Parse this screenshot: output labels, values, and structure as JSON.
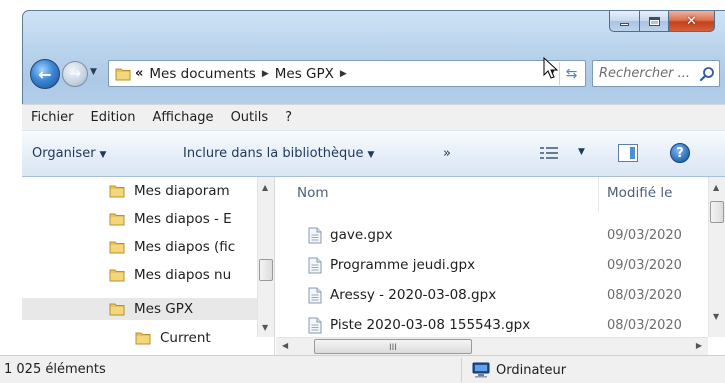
{
  "window": {
    "caption_buttons": [
      "minimize",
      "maximize",
      "close"
    ],
    "accent_color": "#3a86d4"
  },
  "address_bar": {
    "overflow": "«",
    "segments": [
      "Mes documents",
      "Mes GPX"
    ],
    "separator_icon": "chevron-right-icon",
    "dropdown_icon": "chevron-down-icon",
    "refresh_icon": "refresh-icon"
  },
  "search": {
    "placeholder": "Rechercher ...",
    "icon": "search-icon"
  },
  "menu": {
    "items": [
      "Fichier",
      "Edition",
      "Affichage",
      "Outils",
      "?"
    ]
  },
  "commands": {
    "organize": "Organiser",
    "include": "Inclure dans la bibliothèque",
    "more": "»"
  },
  "nav_tree": {
    "items": [
      {
        "label": "Mes diaporam",
        "selected": false
      },
      {
        "label": "Mes diapos - E",
        "selected": false
      },
      {
        "label": "Mes diapos (fic",
        "selected": false
      },
      {
        "label": "Mes diapos nu",
        "selected": false
      },
      {
        "label": "Mes GPX",
        "selected": true
      },
      {
        "label": "Current",
        "selected": false
      }
    ]
  },
  "file_list": {
    "columns": [
      "Nom",
      "Modifié le"
    ],
    "rows": [
      {
        "name": "gave.gpx",
        "modified": "09/03/2020"
      },
      {
        "name": "Programme jeudi.gpx",
        "modified": "09/03/2020"
      },
      {
        "name": "Aressy - 2020-03-08.gpx",
        "modified": "08/03/2020"
      },
      {
        "name": "Piste 2020-03-08 155543.gpx",
        "modified": "08/03/2020"
      }
    ],
    "scroll_grip": "III"
  },
  "status_bar": {
    "item_count": "1 025 éléments",
    "location": "Ordinateur"
  }
}
